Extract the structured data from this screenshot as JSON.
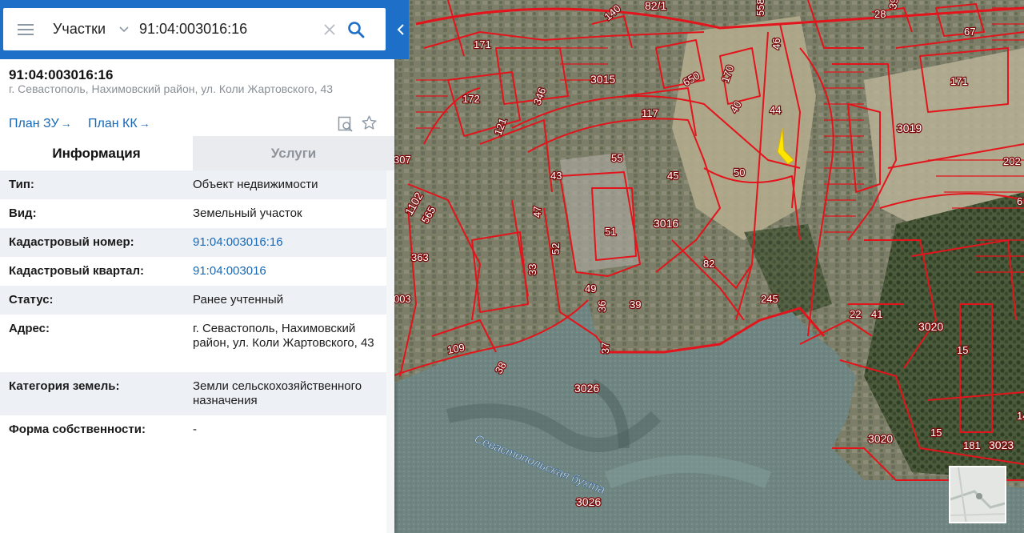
{
  "search": {
    "type_label": "Участки",
    "query": "91:04:003016:16"
  },
  "object": {
    "title": "91:04:003016:16",
    "address": "г. Севастополь, Нахимовский район, ул. Коли Жартовского, 43"
  },
  "links": {
    "plan_zu": "План ЗУ",
    "plan_kk": "План КК",
    "arrow": "→"
  },
  "tabs": {
    "info": "Информация",
    "services": "Услуги"
  },
  "info": [
    {
      "key": "Тип:",
      "value": "Объект недвижимости"
    },
    {
      "key": "Вид:",
      "value": "Земельный участок"
    },
    {
      "key": "Кадастровый номер:",
      "value": "91:04:003016:16"
    },
    {
      "key": "Кадастровый квартал:",
      "value": "91:04:003016"
    },
    {
      "key": "Статус:",
      "value": "Ранее учтенный"
    },
    {
      "key": "Адрес:",
      "value": "г. Севастополь, Нахимовский район, ул. Коли Жартовского, 43"
    },
    {
      "key": "Категория земель:",
      "value": "Земли сельскохозяйственного назначения"
    },
    {
      "key": "Форма собственности:",
      "value": "-"
    }
  ],
  "map": {
    "bay_name": "Севастопольская бухта",
    "labels": [
      "82/1",
      "140",
      "558",
      "39",
      "28",
      "67",
      "171",
      "3015",
      "650",
      "170",
      "46",
      "172",
      "346",
      "117",
      "40",
      "44",
      "171",
      "3019",
      "121",
      "55",
      "43",
      "45",
      "50",
      "307",
      "1102",
      "565",
      "47",
      "52",
      "51",
      "3016",
      "363",
      "33",
      "82",
      "49",
      "39",
      "36",
      "245",
      "22",
      "41",
      "3020",
      "15",
      "003",
      "109",
      "37",
      "38",
      "3026",
      "3020",
      "15",
      "181",
      "3023",
      "3026",
      "202",
      "6",
      "14"
    ],
    "colors": {
      "boundary": "#e3141b",
      "water": "#6f8582",
      "land": "#8f8c6f",
      "marker": "#ffe600"
    }
  },
  "icons": [
    "menu-icon",
    "chevron-down-icon",
    "clear-icon",
    "search-icon",
    "collapse-arrow-icon",
    "preview-icon",
    "star-icon"
  ]
}
